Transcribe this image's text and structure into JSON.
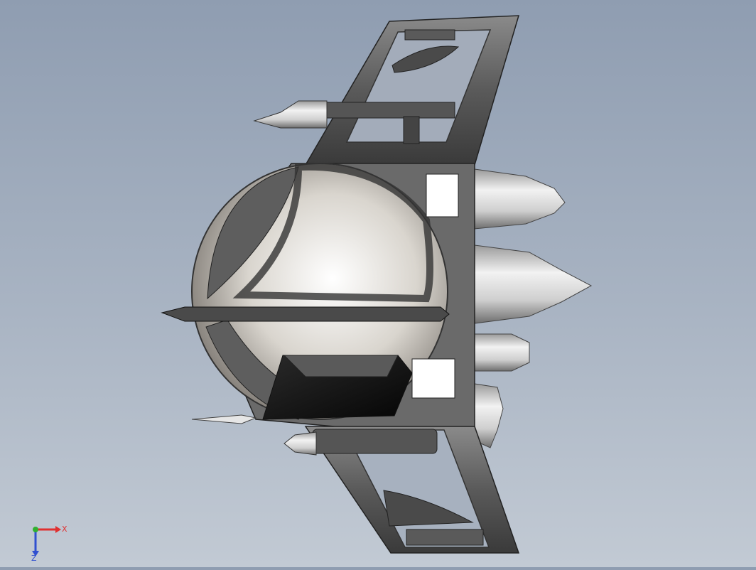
{
  "viewport": {
    "background_top": "#8f9db1",
    "background_bottom": "#c2cad4",
    "model_name": ""
  },
  "triad": {
    "x_label": "X",
    "z_label": "Z",
    "x_color": "#e03030",
    "y_color": "#30b030",
    "z_color": "#3050d0"
  }
}
